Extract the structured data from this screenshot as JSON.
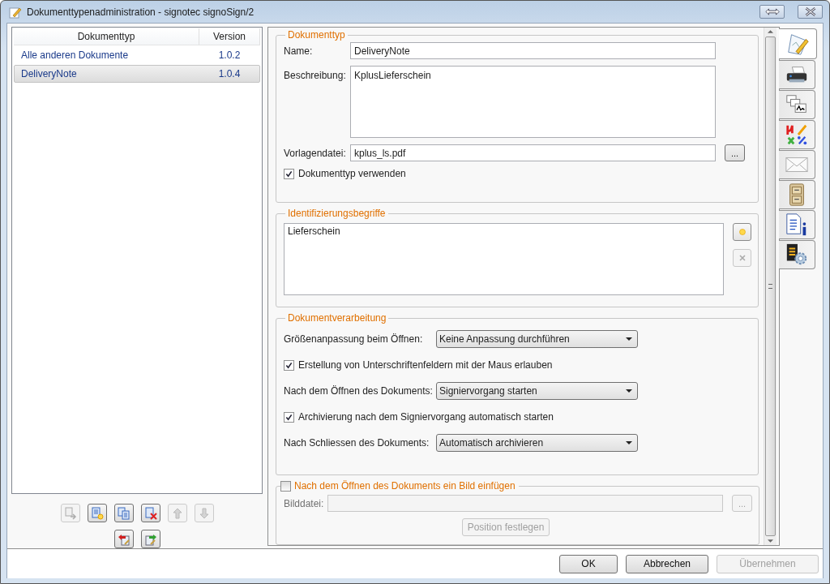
{
  "window": {
    "title": "Dokumenttypenadministration - signotec signoSign/2"
  },
  "document_list": {
    "columns": [
      "Dokumenttyp",
      "Version"
    ],
    "rows": [
      {
        "name": "Alle anderen Dokumente",
        "version": "1.0.2",
        "selected": false
      },
      {
        "name": "DeliveryNote",
        "version": "1.0.4",
        "selected": true
      }
    ]
  },
  "list_toolbar": [
    [
      {
        "kind": "import",
        "disabled": true
      },
      {
        "kind": "new",
        "disabled": false
      },
      {
        "kind": "copy",
        "disabled": false
      },
      {
        "kind": "delete",
        "disabled": false
      },
      {
        "kind": "up",
        "disabled": true
      },
      {
        "kind": "down",
        "disabled": true
      }
    ],
    [
      {
        "kind": "export-left",
        "disabled": false
      },
      {
        "kind": "export-right",
        "disabled": false
      }
    ]
  ],
  "dokumenttyp": {
    "legend": "Dokumenttyp",
    "name": {
      "label": "Name:",
      "value": "DeliveryNote"
    },
    "beschreibung": {
      "label": "Beschreibung:",
      "value": "KplusLieferschein"
    },
    "vorlagendatei": {
      "label": "Vorlagendatei:",
      "value": "kplus_ls.pdf",
      "browse": "..."
    },
    "verwenden": {
      "label": "Dokumenttyp verwenden",
      "checked": true
    }
  },
  "identifizierungsbegriffe": {
    "legend": "Identifizierungsbegriffe",
    "items": [
      "Lieferschein"
    ],
    "add_disabled": false,
    "remove_disabled": true
  },
  "dokumentverarbeitung": {
    "legend": "Dokumentverarbeitung",
    "rows": [
      {
        "kind": "select",
        "label": "Größenanpassung beim Öffnen:",
        "value": "Keine Anpassung durchführen"
      },
      {
        "kind": "checkbox",
        "label": "Erstellung von Unterschriftenfeldern mit der Maus erlauben",
        "checked": true
      },
      {
        "kind": "select",
        "label": "Nach dem Öffnen des Dokuments:",
        "value": "Signiervorgang starten"
      },
      {
        "kind": "checkbox",
        "label": "Archivierung nach dem Signiervorgang automatisch starten",
        "checked": true
      },
      {
        "kind": "select",
        "label": "Nach Schliessen des Dokuments:",
        "value": "Automatisch archivieren"
      }
    ]
  },
  "bild": {
    "legend": "Nach dem Öffnen des Dokuments ein Bild einfügen",
    "checked": false,
    "bilddatei_label": "Bilddatei:",
    "browse": "...",
    "position_button": "Position festlegen",
    "disabled": true
  },
  "side_tabs": [
    {
      "kind": "edit",
      "selected": true
    },
    {
      "kind": "printer",
      "selected": false
    },
    {
      "kind": "signatures",
      "selected": false
    },
    {
      "kind": "symbols",
      "selected": false
    },
    {
      "kind": "mail",
      "selected": false
    },
    {
      "kind": "cabinet",
      "selected": false
    },
    {
      "kind": "info",
      "selected": false
    },
    {
      "kind": "settings",
      "selected": false
    }
  ],
  "footer_buttons": [
    {
      "label": "OK",
      "disabled": false
    },
    {
      "label": "Abbrechen",
      "disabled": false
    },
    {
      "label": "Übernehmen",
      "disabled": true
    }
  ]
}
